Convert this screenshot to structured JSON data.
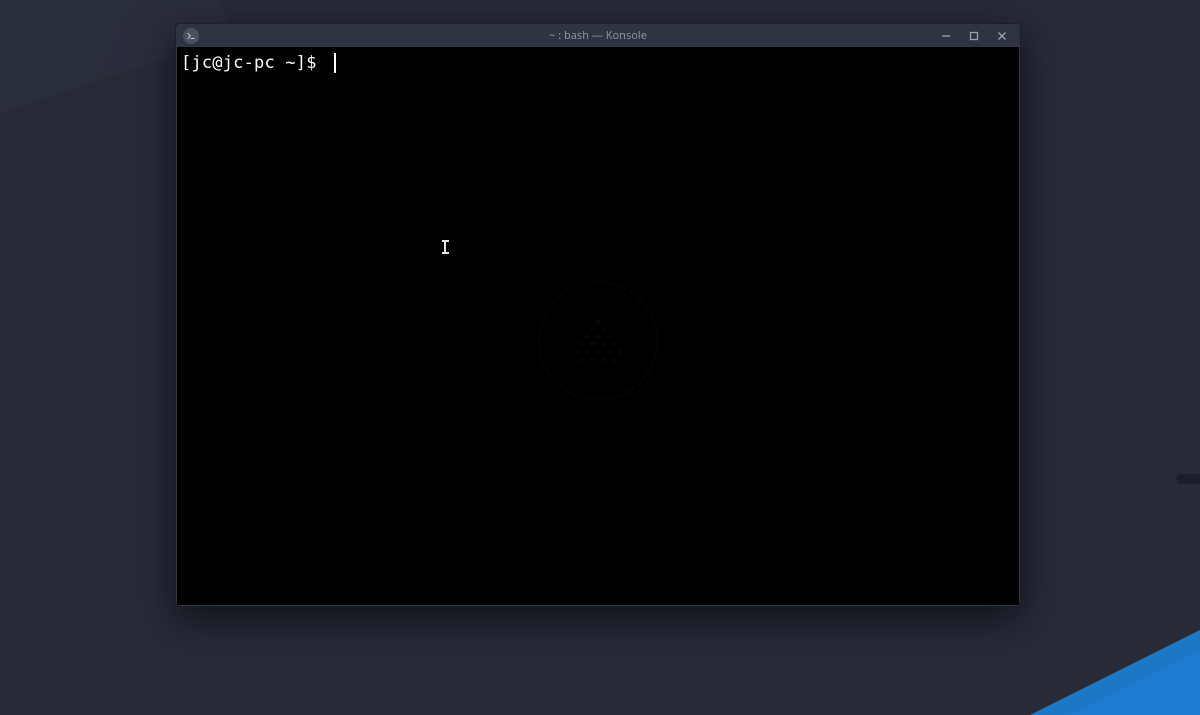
{
  "window": {
    "title": "~ : bash — Konsole",
    "app_icon": "terminal-icon"
  },
  "controls": {
    "minimize": "minimize",
    "maximize": "maximize",
    "close": "close"
  },
  "terminal": {
    "prompt": "[jc@jc-pc ~]$ ",
    "input": "",
    "cursor_visible": true
  },
  "colors": {
    "titlebar_bg": "#2e3440",
    "terminal_bg": "#000000",
    "prompt_fg": "#ffffff",
    "desktop_bg": "#272b38",
    "accent": "#1d7fd6"
  }
}
